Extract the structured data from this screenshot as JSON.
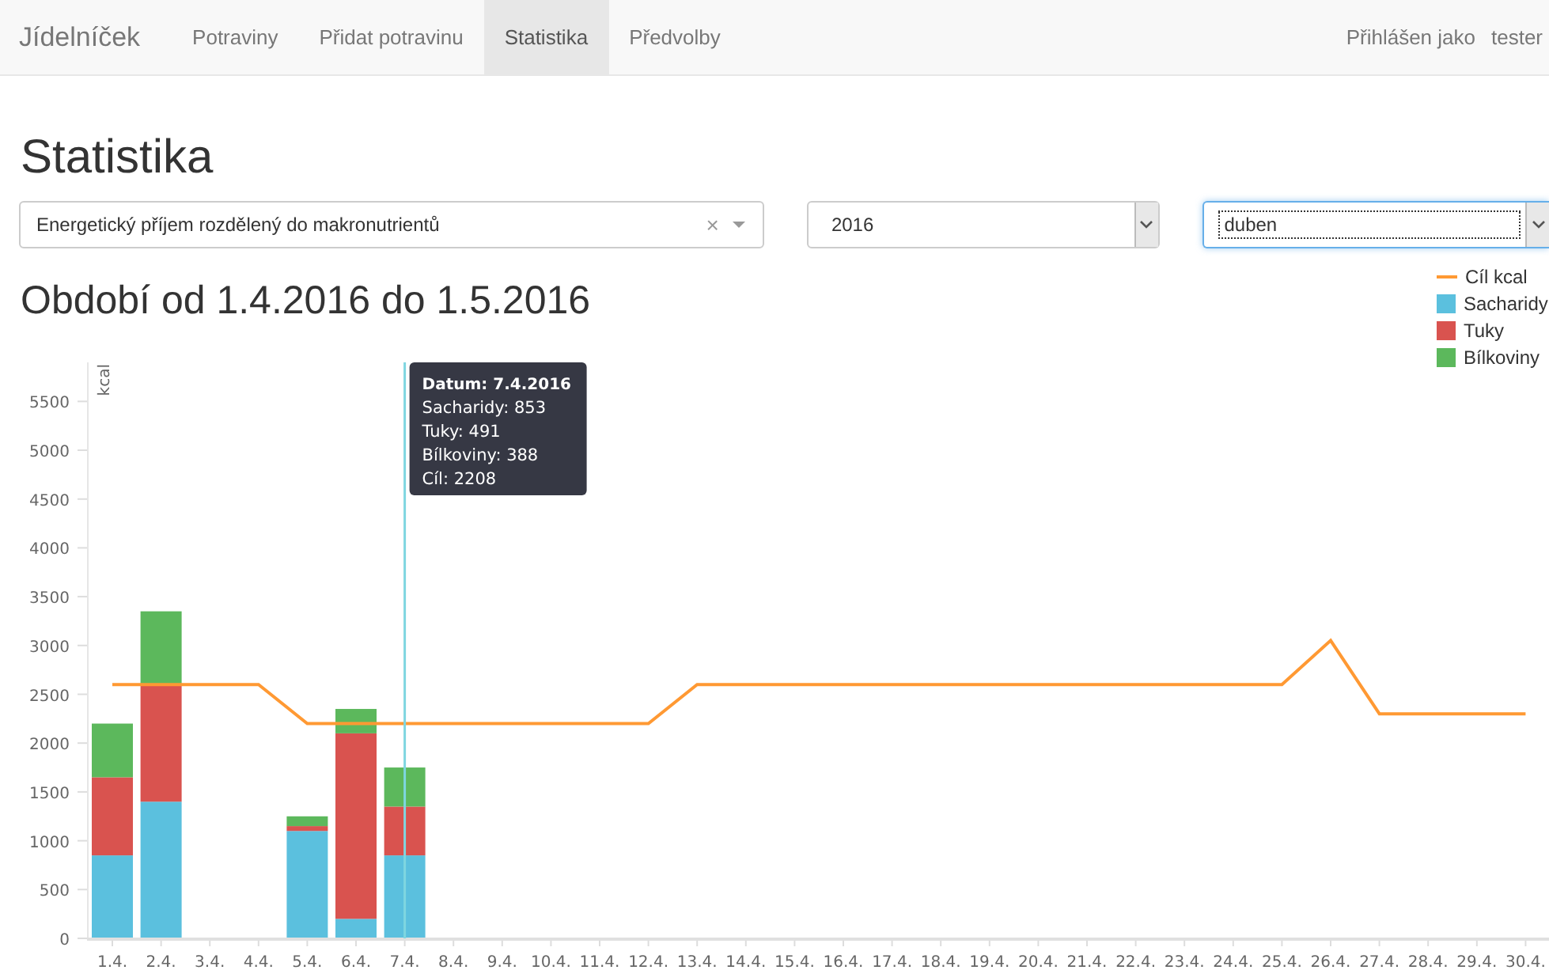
{
  "navbar": {
    "brand": "Jídelníček",
    "items": [
      {
        "label": "Potraviny",
        "selected": false
      },
      {
        "label": "Přidat potravinu",
        "selected": false
      },
      {
        "label": "Statistika",
        "selected": true
      },
      {
        "label": "Předvolby",
        "selected": false
      }
    ],
    "login_text": "Přihlášen jako",
    "user": "tester"
  },
  "page_title": "Statistika",
  "filters": {
    "report": {
      "value": "Energetický příjem rozdělený do makronutrientů",
      "clear": "×"
    },
    "year": {
      "value": "2016"
    },
    "month": {
      "value": "duben"
    }
  },
  "period_title": "Období od 1.4.2016 do 1.5.2016",
  "tooltip": {
    "title": "Datum: 7.4.2016",
    "lines": [
      "Sacharidy: 853",
      "Tuky: 491",
      "Bílkoviny: 388",
      "Cíl: 2208"
    ]
  },
  "chart_data": {
    "type": "bar",
    "stacked": true,
    "ylabel": "kcal",
    "ylim": [
      0,
      5900
    ],
    "yticks": [
      0,
      500,
      1000,
      1500,
      2000,
      2500,
      3000,
      3500,
      4000,
      4500,
      5000,
      5500
    ],
    "categories": [
      "1.4.",
      "2.4.",
      "3.4.",
      "4.4.",
      "5.4.",
      "6.4.",
      "7.4.",
      "8.4.",
      "9.4.",
      "10.4.",
      "11.4.",
      "12.4.",
      "13.4.",
      "14.4.",
      "15.4.",
      "16.4.",
      "17.4.",
      "18.4.",
      "19.4.",
      "20.4.",
      "21.4.",
      "22.4.",
      "23.4.",
      "24.4.",
      "25.4.",
      "26.4.",
      "27.4.",
      "28.4.",
      "29.4.",
      "30.4."
    ],
    "series": [
      {
        "name": "Cíl kcal",
        "color": "#ff9933",
        "type": "line",
        "values": [
          2600,
          2600,
          2600,
          2600,
          2200,
          2200,
          2200,
          2200,
          2200,
          2200,
          2200,
          2200,
          2600,
          2600,
          2600,
          2600,
          2600,
          2600,
          2600,
          2600,
          2600,
          2600,
          2600,
          2600,
          2600,
          3050,
          2300,
          2300,
          2300,
          2300
        ]
      },
      {
        "name": "Sacharidy",
        "color": "#5bc0de",
        "type": "bar",
        "values": [
          850,
          1400,
          null,
          null,
          1100,
          200,
          850,
          null,
          null,
          null,
          null,
          null,
          null,
          null,
          null,
          null,
          null,
          null,
          null,
          null,
          null,
          null,
          null,
          null,
          null,
          null,
          null,
          null,
          null,
          null
        ]
      },
      {
        "name": "Tuky",
        "color": "#d9534f",
        "type": "bar",
        "values": [
          800,
          1200,
          null,
          null,
          50,
          1900,
          500,
          null,
          null,
          null,
          null,
          null,
          null,
          null,
          null,
          null,
          null,
          null,
          null,
          null,
          null,
          null,
          null,
          null,
          null,
          null,
          null,
          null,
          null,
          null
        ]
      },
      {
        "name": "Bílkoviny",
        "color": "#5cb85c",
        "type": "bar",
        "values": [
          550,
          750,
          null,
          null,
          100,
          250,
          400,
          null,
          null,
          null,
          null,
          null,
          null,
          null,
          null,
          null,
          null,
          null,
          null,
          null,
          null,
          null,
          null,
          null,
          null,
          null,
          null,
          null,
          null,
          null
        ]
      }
    ]
  }
}
